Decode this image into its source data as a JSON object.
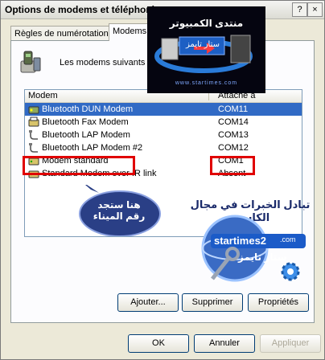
{
  "window": {
    "title": "Options de modems et téléphonie"
  },
  "titlebar_buttons": {
    "help": "?",
    "close": "×"
  },
  "tabs": [
    {
      "label": "Règles de numérotation",
      "active": false
    },
    {
      "label": "Modems",
      "active": true
    }
  ],
  "intro_text": "Les modems suivants sont installés :",
  "list": {
    "col_modem": "Modem",
    "col_port": "Attaché à",
    "rows": [
      {
        "name": "Bluetooth DUN Modem",
        "port": "COM11",
        "selected": true
      },
      {
        "name": "Bluetooth Fax Modem",
        "port": "COM14",
        "selected": false
      },
      {
        "name": "Bluetooth LAP Modem",
        "port": "COM13",
        "selected": false
      },
      {
        "name": "Bluetooth LAP Modem #2",
        "port": "COM12",
        "selected": false
      },
      {
        "name": "Modem standard",
        "port": "COM1",
        "selected": false
      },
      {
        "name": "Standard Modem over IR link",
        "port": "Absent",
        "selected": false
      }
    ]
  },
  "buttons": {
    "add": "Ajouter...",
    "remove": "Supprimer",
    "properties": "Propriétés"
  },
  "footer": {
    "ok": "OK",
    "cancel": "Annuler",
    "apply": "Appliquer"
  },
  "overlay": {
    "bubble_text": "هنا ستجد رقم الميناء",
    "logo_top_arabic": "منتدى الكمبيوتر",
    "logo_top_small": "ستار تايمز",
    "logo_url": "www.startimes.com",
    "watermark_arabic": "تبادل الخبرات في مجال الكاسب",
    "watermark_en": "startimes2",
    "watermark_com": ".com",
    "watermark_ar2": "ستار تايمز"
  },
  "colors": {
    "selection": "#316ac5",
    "highlight_box": "#e00000",
    "bubble": "#2a3f86"
  }
}
